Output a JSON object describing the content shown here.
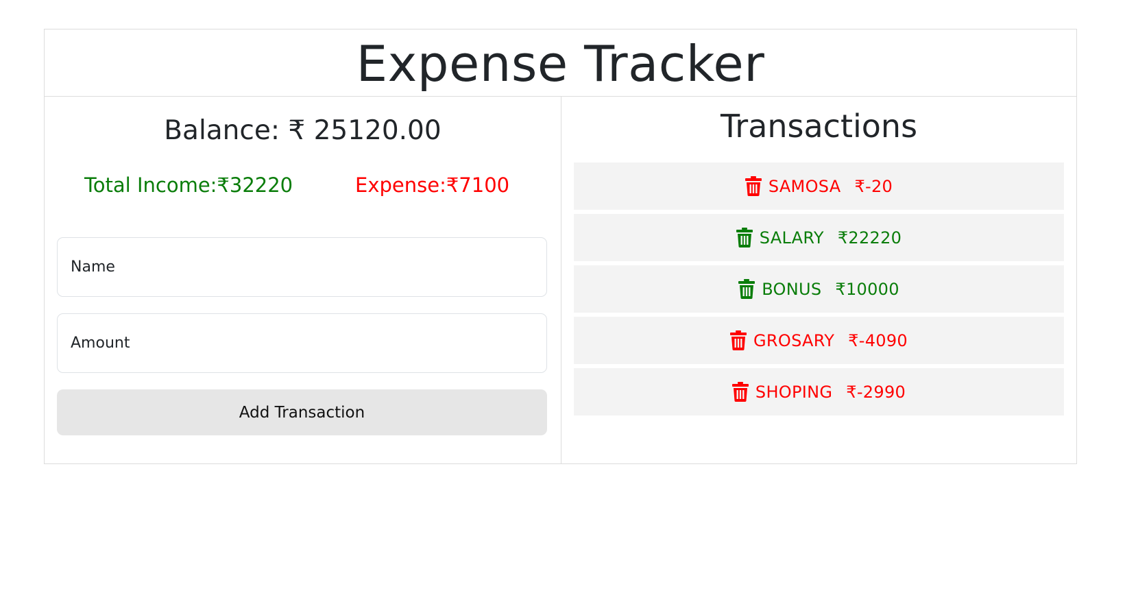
{
  "app": {
    "title": "Expense Tracker"
  },
  "summary": {
    "balance_text": "Balance: ₹ 25120.00",
    "income_text": "Total Income:₹32220",
    "expense_text": "Expense:₹7100"
  },
  "form": {
    "name_placeholder": "Name",
    "amount_placeholder": "Amount",
    "submit_label": "Add Transaction"
  },
  "transactions": {
    "heading": "Transactions",
    "items": [
      {
        "name": "SAMOSA",
        "amount": "₹-20",
        "type": "expense",
        "icon": "trash-icon"
      },
      {
        "name": "SALARY",
        "amount": "₹22220",
        "type": "income",
        "icon": "trash-icon"
      },
      {
        "name": "BONUS",
        "amount": "₹10000",
        "type": "income",
        "icon": "trash-icon"
      },
      {
        "name": "GROSARY",
        "amount": "₹-4090",
        "type": "expense",
        "icon": "trash-icon"
      },
      {
        "name": "SHOPING",
        "amount": "₹-2990",
        "type": "expense",
        "icon": "trash-icon"
      }
    ]
  },
  "colors": {
    "income": "#0a7d0a",
    "expense": "#ff0000",
    "item_background": "#f3f3f3",
    "button_background": "#e6e6e6"
  }
}
